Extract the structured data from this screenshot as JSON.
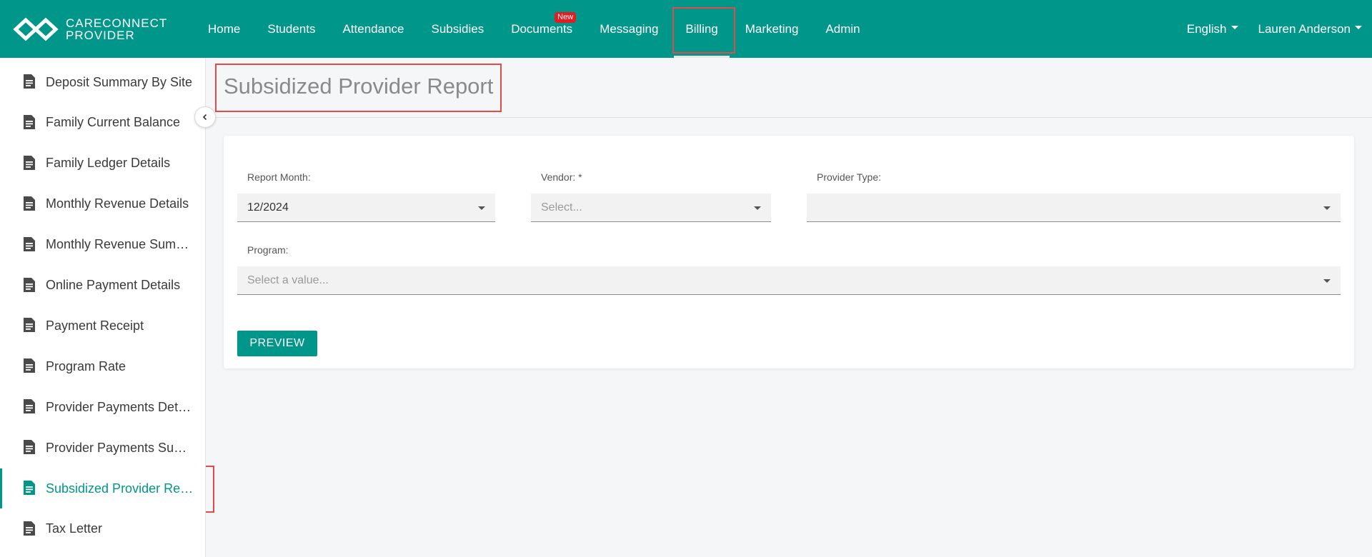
{
  "brand": {
    "line1": "CARECONNECT",
    "line2": "PROVIDER"
  },
  "nav": {
    "items": [
      {
        "label": "Home"
      },
      {
        "label": "Students"
      },
      {
        "label": "Attendance"
      },
      {
        "label": "Subsidies"
      },
      {
        "label": "Documents",
        "badge": "New"
      },
      {
        "label": "Messaging"
      },
      {
        "label": "Billing",
        "active": true
      },
      {
        "label": "Marketing"
      },
      {
        "label": "Admin"
      }
    ],
    "language": "English",
    "user": "Lauren Anderson"
  },
  "sidebar": {
    "items": [
      {
        "label": "Deposit Summary By Site"
      },
      {
        "label": "Family Current Balance"
      },
      {
        "label": "Family Ledger Details"
      },
      {
        "label": "Monthly Revenue Details"
      },
      {
        "label": "Monthly Revenue Summary"
      },
      {
        "label": "Online Payment Details"
      },
      {
        "label": "Payment Receipt"
      },
      {
        "label": "Program Rate"
      },
      {
        "label": "Provider Payments Details"
      },
      {
        "label": "Provider Payments Summary"
      },
      {
        "label": "Subsidized Provider Report",
        "active": true
      },
      {
        "label": "Tax Letter"
      }
    ]
  },
  "page": {
    "title": "Subsidized Provider Report"
  },
  "form": {
    "report_month": {
      "label": "Report Month:",
      "value": "12/2024"
    },
    "vendor": {
      "label": "Vendor: *",
      "placeholder": "Select..."
    },
    "provider_type": {
      "label": "Provider Type:",
      "value": ""
    },
    "program": {
      "label": "Program:",
      "placeholder": "Select a value..."
    },
    "preview_label": "PREVIEW"
  },
  "colors": {
    "brand": "#00968a",
    "badge": "#e31b23",
    "highlight": "#e34a4a"
  }
}
